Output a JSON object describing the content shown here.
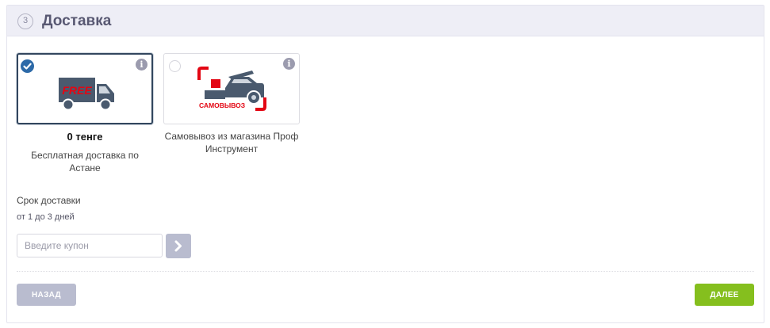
{
  "header": {
    "step_number": "3",
    "title": "Доставка"
  },
  "options": [
    {
      "id": "free",
      "selected": true,
      "image_text": "FREE",
      "price": "0 тенге",
      "description": "Бесплатная доставка по Астане"
    },
    {
      "id": "pickup",
      "selected": false,
      "image_text": "САМОВЫВОЗ",
      "description": "Самовывоз из магазина Проф Инструмент"
    }
  ],
  "delivery": {
    "term_label": "Срок доставки",
    "term_value": "от 1 до 3 дней"
  },
  "coupon": {
    "placeholder": "Введите купон",
    "value": ""
  },
  "actions": {
    "back_label": "НАЗАД",
    "next_label": "ДАЛЕЕ"
  },
  "colors": {
    "accent_selected": "#32465e",
    "check": "#2d6aa8",
    "next": "#85bf1e",
    "muted_button": "#b9bccf",
    "logo_red": "#e30613"
  },
  "icons": {
    "check": "check-icon",
    "info": "info-icon",
    "truck": "truck-icon",
    "car": "car-icon",
    "arrow": "chevron-right-icon"
  }
}
